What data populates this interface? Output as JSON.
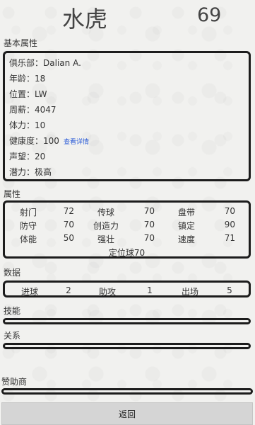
{
  "header": {
    "name": "水虎",
    "rating": "69"
  },
  "basic": {
    "title": "基本属性",
    "rows": [
      {
        "label": "俱乐部",
        "sep": "：",
        "value": "Dalian A."
      },
      {
        "label": "年龄",
        "sep": "：",
        "value": "18"
      },
      {
        "label": "位置",
        "sep": "：",
        "value": "LW"
      },
      {
        "label": "周薪",
        "sep": "：",
        "value": "4047"
      },
      {
        "label": "体力",
        "sep": "：",
        "value": "10"
      },
      {
        "label": "健康度",
        "sep": "：",
        "value": "100"
      },
      {
        "label": "声望",
        "sep": "：",
        "value": "20"
      },
      {
        "label": "潜力",
        "sep": "：",
        "value": "极高"
      }
    ],
    "detail_link": "查看详情"
  },
  "attributes": {
    "title": "属性",
    "rows": [
      [
        {
          "name": "射门",
          "value": "72"
        },
        {
          "name": "传球",
          "value": "70"
        },
        {
          "name": "盘带",
          "value": "70"
        }
      ],
      [
        {
          "name": "防守",
          "value": "70"
        },
        {
          "name": "创造力",
          "value": "70"
        },
        {
          "name": "镇定",
          "value": "90"
        }
      ],
      [
        {
          "name": "体能",
          "value": "50"
        },
        {
          "name": "强壮",
          "value": "70"
        },
        {
          "name": "速度",
          "value": "71"
        }
      ]
    ],
    "extra": "定位球70"
  },
  "data": {
    "title": "数据",
    "items": [
      {
        "name": "进球",
        "value": "2"
      },
      {
        "name": "助攻",
        "value": "1"
      },
      {
        "name": "出场",
        "value": "5"
      }
    ]
  },
  "skills": {
    "title": "技能"
  },
  "relations": {
    "title": "关系"
  },
  "sponsor": {
    "title": "赞助商"
  },
  "back_button": "返回"
}
